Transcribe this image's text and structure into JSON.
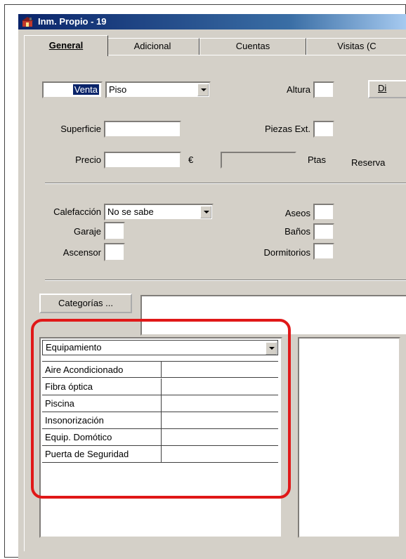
{
  "window": {
    "title": "Inm. Propio - 19",
    "title_icon": "app-icon"
  },
  "tabs": [
    {
      "label": "General",
      "active": true
    },
    {
      "label": "Adicional",
      "active": false
    },
    {
      "label": "Cuentas",
      "active": false
    },
    {
      "label": "Visitas (C",
      "active": false
    }
  ],
  "general": {
    "operacion": "Venta",
    "tipo": "Piso",
    "altura_label": "Altura",
    "altura_value": "",
    "di_button": "Di",
    "superficie_label": "Superficie",
    "superficie_value": "",
    "piezas_label": "Piezas Ext.",
    "piezas_value": "",
    "precio_label": "Precio",
    "precio_value": "",
    "euro_symbol": "€",
    "ptas_label": "Ptas",
    "ptas_value": "",
    "reserva_label": "Reserva",
    "calefaccion_label": "Calefacción",
    "calefaccion_value": "No se sabe",
    "aseos_label": "Aseos",
    "aseos_value": "",
    "garaje_label": "Garaje",
    "garaje_value": "",
    "banos_label": "Baños",
    "banos_value": "",
    "ascensor_label": "Ascensor",
    "ascensor_value": "",
    "dormitorios_label": "Dormitorios",
    "dormitorios_value": "",
    "categorias_button": "Categorías ...",
    "categorias_value": ""
  },
  "equipamiento": {
    "header": "Equipamiento",
    "rows": [
      {
        "name": "Aire Acondicionado",
        "value": ""
      },
      {
        "name": "Fibra óptica",
        "value": ""
      },
      {
        "name": "Piscina",
        "value": ""
      },
      {
        "name": "Insonorización",
        "value": ""
      },
      {
        "name": "Equip. Domótico",
        "value": ""
      },
      {
        "name": "Puerta de Seguridad",
        "value": ""
      }
    ]
  },
  "colors": {
    "title_bar": "#0a246a",
    "highlight": "#e01818",
    "face": "#d4d0c8"
  }
}
